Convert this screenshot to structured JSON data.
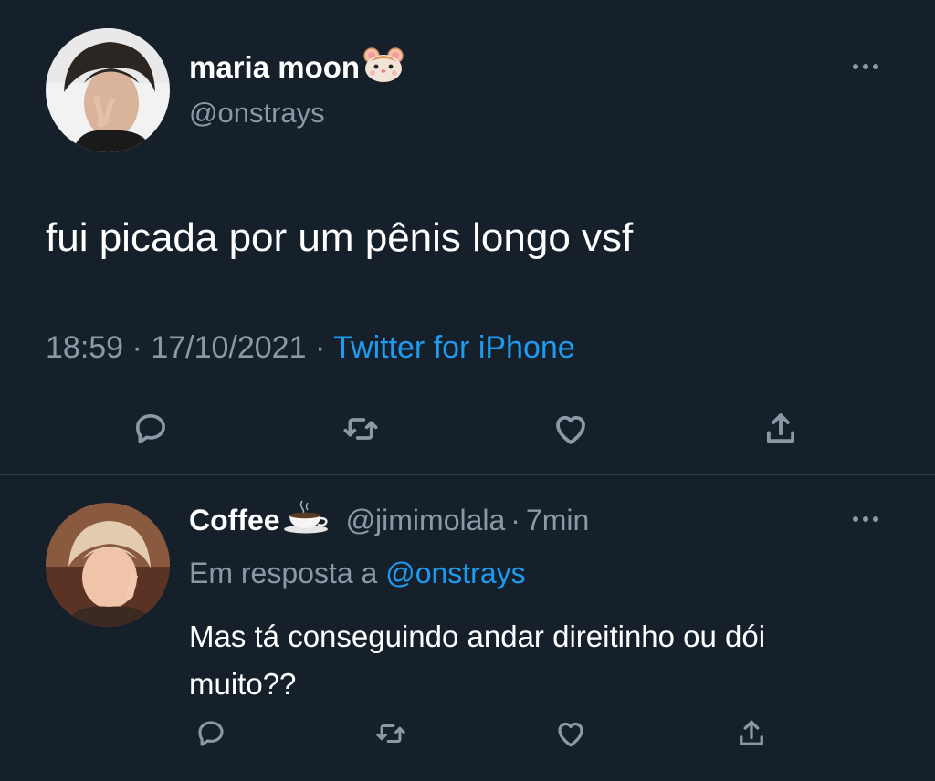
{
  "tweet": {
    "display_name": "maria moon",
    "name_emoji": "hamster-face-icon",
    "handle": "@onstrays",
    "text": "fui picada por um pênis longo vsf",
    "time": "18:59",
    "separator": "·",
    "date": "17/10/2021",
    "source": "Twitter for iPhone"
  },
  "reply": {
    "display_name": "Coffee",
    "name_emoji": "coffee-cup-icon",
    "handle": "@jimimolala",
    "separator": "·",
    "time_ago": "7min",
    "reply_prefix": "Em resposta a",
    "reply_to": "@onstrays",
    "text_line1": "Mas tá conseguindo andar direitinho ou dói",
    "text_line2": "muito??"
  },
  "colors": {
    "background": "#15202b",
    "text": "#ffffff",
    "muted": "#8b98a5",
    "link": "#1d9bf0",
    "divider": "#2f3b47"
  },
  "icons": {
    "actions": [
      "reply-icon",
      "retweet-icon",
      "like-icon",
      "share-icon"
    ],
    "menu": "more-options-icon"
  }
}
